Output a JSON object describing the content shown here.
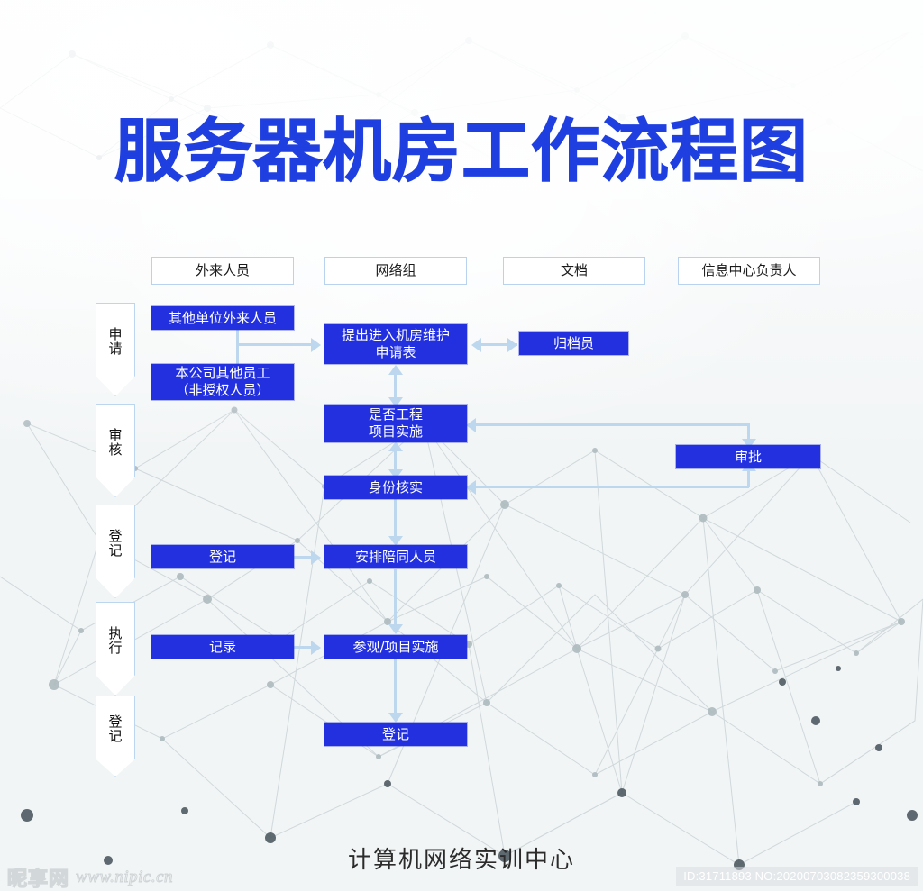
{
  "page": {
    "title": "服务器机房工作流程图",
    "footer": "计算机网络实训中心"
  },
  "colors": {
    "title_blue": "#1f3fe0",
    "box_blue": "#2230e0",
    "connector_blue": "#bcd7ee",
    "header_border": "#b9d3ee",
    "box_text": "#ffffff"
  },
  "headers": [
    {
      "label": "外来人员"
    },
    {
      "label": "网络组"
    },
    {
      "label": "文档"
    },
    {
      "label": "信息中心负责人"
    }
  ],
  "phases": [
    {
      "label": "申请"
    },
    {
      "label": "审核"
    },
    {
      "label": "登记"
    },
    {
      "label": "执行"
    },
    {
      "label": "登记"
    }
  ],
  "boxes": [
    {
      "id": "outsider",
      "label": "其他单位外来人员"
    },
    {
      "id": "employee",
      "label": "本公司其他员工\n（非授权人员）"
    },
    {
      "id": "apply-form",
      "label": "提出进入机房维护\n申请表"
    },
    {
      "id": "archivist",
      "label": "归档员"
    },
    {
      "id": "is-project",
      "label": "是否工程\n项目实施"
    },
    {
      "id": "approval",
      "label": "审批"
    },
    {
      "id": "identity-check",
      "label": "身份核实"
    },
    {
      "id": "register-1",
      "label": "登记"
    },
    {
      "id": "arrange-escort",
      "label": "安排陪同人员"
    },
    {
      "id": "record",
      "label": "记录"
    },
    {
      "id": "visit-implement",
      "label": "参观/项目实施"
    },
    {
      "id": "register-2",
      "label": "登记"
    }
  ],
  "watermark": {
    "logo": "昵享网",
    "url": "www.nipic.cn",
    "id_line": "ID:31711893 NO:20200703082359300038"
  }
}
